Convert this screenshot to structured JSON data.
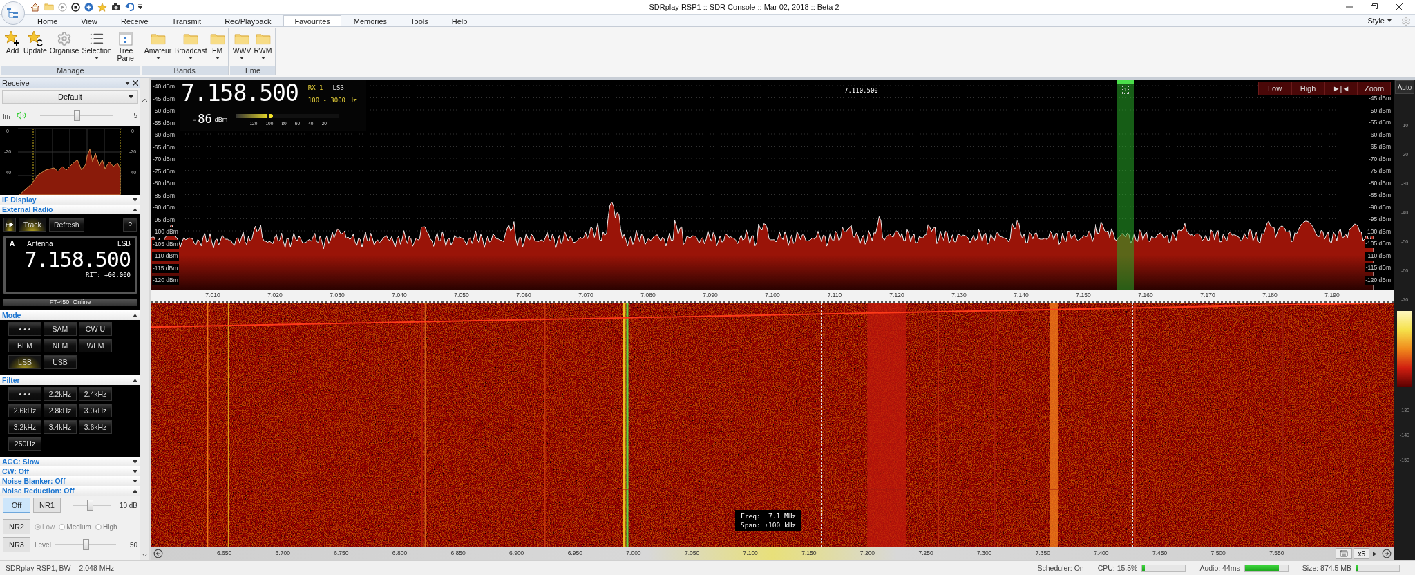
{
  "title_bar": {
    "title": "SDRplay RSP1 :: SDR Console :: Mar 02, 2018 :: Beta 2"
  },
  "menu_tabs": [
    {
      "label": "Home",
      "selected": false
    },
    {
      "label": "View",
      "selected": false
    },
    {
      "label": "Receive",
      "selected": false
    },
    {
      "label": "Transmit",
      "selected": false
    },
    {
      "label": "Rec/Playback",
      "selected": false
    },
    {
      "label": "Favourites",
      "selected": true
    },
    {
      "label": "Memories",
      "selected": false
    },
    {
      "label": "Tools",
      "selected": false
    },
    {
      "label": "Help",
      "selected": false
    }
  ],
  "style_menu": "Style",
  "ribbon": [
    {
      "title": "Manage",
      "buttons": [
        {
          "label": "Add",
          "kind": "add",
          "dropdown": false
        },
        {
          "label": "Update",
          "kind": "update",
          "dropdown": false
        },
        {
          "label": "Organise",
          "kind": "organise",
          "dropdown": false
        },
        {
          "label": "Selection",
          "kind": "selection",
          "dropdown": true
        },
        {
          "label": "Tree Pane",
          "kind": "tree",
          "dropdown": false
        }
      ]
    },
    {
      "title": "Bands",
      "buttons": [
        {
          "label": "Amateur",
          "kind": "folder",
          "dropdown": true
        },
        {
          "label": "Broadcast",
          "kind": "folder",
          "dropdown": true
        },
        {
          "label": "FM",
          "kind": "folder",
          "dropdown": true
        }
      ]
    },
    {
      "title": "Time",
      "buttons": [
        {
          "label": "WWV",
          "kind": "folder",
          "dropdown": true
        },
        {
          "label": "RWM",
          "kind": "folder",
          "dropdown": true
        }
      ]
    }
  ],
  "receive_panel": {
    "title": "Receive",
    "profile": "Default",
    "volume": {
      "level": 0.5,
      "reading": "5"
    },
    "if_display": {
      "left_ticks": [
        "0",
        "-20",
        "-40"
      ],
      "right_ticks": [
        "0",
        "-20",
        "-40"
      ]
    },
    "if_display_header": {
      "label": "IF Display",
      "expanded": false
    },
    "external_radio": {
      "header": {
        "label": "External Radio",
        "expanded": true
      },
      "buttons": [
        {
          "kind": "icon",
          "on": true
        },
        {
          "kind": "text",
          "label": "Track",
          "on": true
        },
        {
          "kind": "text",
          "label": "Refresh",
          "on": false
        },
        {
          "kind": "help",
          "label": "?",
          "on": false
        }
      ],
      "vfo": "A",
      "antenna": "Antenna",
      "mode": "LSB",
      "frequency": "7.158.500",
      "rit": "RIT: +00.000",
      "status": "FT-450, Online"
    },
    "mode_section": {
      "header": {
        "label": "Mode",
        "expanded": true
      },
      "buttons": [
        {
          "label": "• • •",
          "selected": false
        },
        {
          "label": "SAM",
          "selected": false
        },
        {
          "label": "CW-U",
          "selected": false
        },
        {
          "label": "BFM",
          "selected": false
        },
        {
          "label": "NFM",
          "selected": false
        },
        {
          "label": "WFM",
          "selected": false
        },
        {
          "label": "LSB",
          "selected": true
        },
        {
          "label": "USB",
          "selected": false
        }
      ]
    },
    "filter_section": {
      "header": {
        "label": "Filter",
        "expanded": true
      },
      "buttons": [
        {
          "label": "• • •",
          "selected": false
        },
        {
          "label": "2.2kHz",
          "selected": false
        },
        {
          "label": "2.4kHz",
          "selected": false
        },
        {
          "label": "2.6kHz",
          "selected": false
        },
        {
          "label": "2.8kHz",
          "selected": false
        },
        {
          "label": "3.0kHz",
          "selected": false
        },
        {
          "label": "3.2kHz",
          "selected": false
        },
        {
          "label": "3.4kHz",
          "selected": false
        },
        {
          "label": "3.6kHz",
          "selected": false
        },
        {
          "label": "250Hz",
          "selected": false
        }
      ]
    },
    "collapsed_sections": [
      {
        "label": "AGC: Slow",
        "expanded": false
      },
      {
        "label": "CW: Off",
        "expanded": false
      },
      {
        "label": "Noise Blanker: Off",
        "expanded": false
      }
    ],
    "noise_reduction": {
      "header": {
        "label": "Noise Reduction: Off",
        "expanded": true
      },
      "nr_buttons": [
        {
          "label": "Off",
          "selected": true
        },
        {
          "label": "NR1",
          "selected": false
        }
      ],
      "nr1_slider": {
        "level": 0.45,
        "reading": "10 dB"
      },
      "nr2": {
        "label": "NR2",
        "selected": false
      },
      "nr2_options": [
        {
          "label": "Low",
          "selected": true
        },
        {
          "label": "Medium",
          "selected": false
        },
        {
          "label": "High",
          "selected": false
        }
      ],
      "nr3": {
        "label": "NR3",
        "selected": false
      },
      "level_label": "Level",
      "level_slider": {
        "level": 0.5,
        "reading": "50"
      }
    }
  },
  "spectrum": {
    "frequency": "7.158.500",
    "receiver": "RX 1",
    "mode": "LSB",
    "passband": "100 - 3000 Hz",
    "signal": "-86",
    "signal_unit": "dBm",
    "smeter": {
      "level": 0.36,
      "ticks": [
        "-120",
        "-100",
        "-80",
        "-60",
        "-40",
        "-20"
      ]
    },
    "marker_label": "7.110.500",
    "channel_label": "1",
    "db_labels_left": [
      "-40 dBm",
      "-45 dBm",
      "-50 dBm",
      "-55 dBm",
      "-60 dBm",
      "-65 dBm",
      "-70 dBm",
      "-75 dBm",
      "-80 dBm",
      "-85 dBm",
      "-90 dBm",
      "-95 dBm",
      "-100 dBm",
      "-105 dBm",
      "-110 dBm",
      "-115 dBm",
      "-120 dBm"
    ],
    "db_labels_right": [
      "-45 dBm",
      "-50 dBm",
      "-55 dBm",
      "-60 dBm",
      "-65 dBm",
      "-70 dBm",
      "-75 dBm",
      "-80 dBm",
      "-85 dBm",
      "-90 dBm",
      "-95 dBm",
      "-100 dBm",
      "-105 dBm",
      "-110 dBm",
      "-115 dBm",
      "-120 dBm"
    ],
    "freq_labels": [
      "7.010",
      "7.020",
      "7.030",
      "7.040",
      "7.050",
      "7.060",
      "7.070",
      "7.080",
      "7.090",
      "7.100",
      "7.110",
      "7.120",
      "7.130",
      "7.140",
      "7.150",
      "7.160",
      "7.170",
      "7.180",
      "7.190"
    ],
    "controls": [
      "Low",
      "High",
      "►|◄",
      "Zoom"
    ]
  },
  "waterfall": {
    "tooltip": [
      "Freq:  7.1 MHz",
      "Span: ±100 kHz"
    ],
    "freq_labels": [
      "6.650",
      "6.700",
      "6.750",
      "6.800",
      "6.850",
      "6.900",
      "6.950",
      "7.000",
      "7.050",
      "7.100",
      "7.150",
      "7.200",
      "7.250",
      "7.300",
      "7.350",
      "7.400",
      "7.450",
      "7.500",
      "7.550"
    ],
    "zoom": "x5"
  },
  "level_scale": {
    "auto": "Auto",
    "upper": [
      "-10",
      "-20",
      "-30",
      "-40",
      "-50",
      "-60",
      "-70"
    ],
    "lower": [
      "-130",
      "-140",
      "-150"
    ]
  },
  "status_bar": {
    "device": "SDRplay RSP1, BW = 2.048 MHz",
    "scheduler": "Scheduler: On",
    "meters": [
      {
        "label": "CPU: 15.5%",
        "level": 0.06
      },
      {
        "label": "Audio: 44ms",
        "level": 0.8
      },
      {
        "label": "Size: 874.5 MB",
        "level": 0.03
      }
    ]
  }
}
